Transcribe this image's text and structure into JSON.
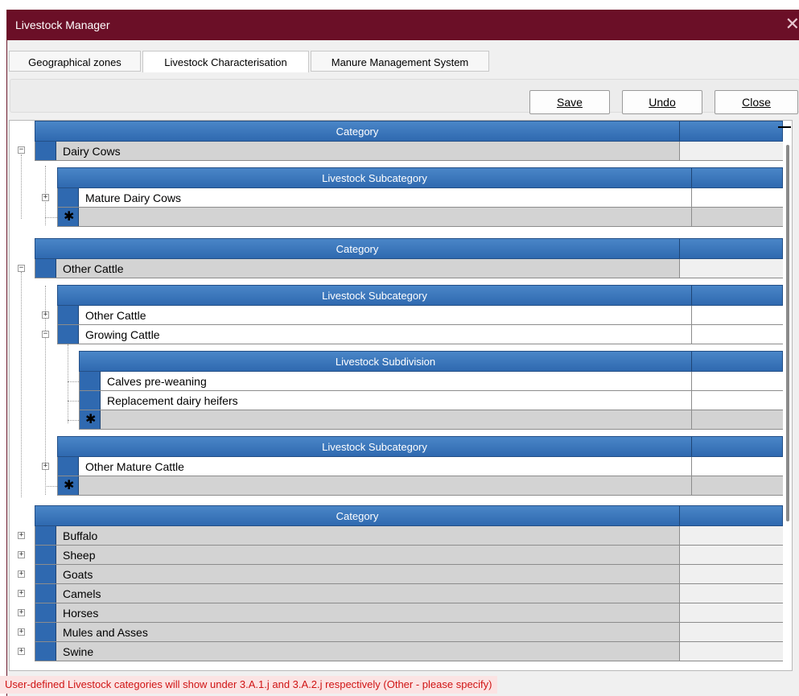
{
  "window": {
    "title": "Livestock Manager",
    "close_glyph": "✕"
  },
  "tabs": [
    {
      "label": "Geographical zones",
      "active": false
    },
    {
      "label": "Livestock Characterisation",
      "active": true
    },
    {
      "label": "Manure Management System",
      "active": false
    }
  ],
  "toolbar": {
    "save_label": "Save",
    "undo_label": "Undo",
    "close_label": "Close"
  },
  "headers": {
    "category": "Category",
    "subcategory": "Livestock Subcategory",
    "subdivision": "Livestock Subdivision"
  },
  "new_row_glyph": "✱",
  "expand_glyph": "+",
  "collapse_glyph": "−",
  "tree": {
    "dairy_cows": {
      "label": "Dairy Cows",
      "subcategories": [
        "Mature Dairy Cows"
      ]
    },
    "other_cattle": {
      "label": "Other Cattle",
      "subcategories": [
        "Other Cattle",
        "Growing Cattle"
      ],
      "growing_subdivisions": [
        "Calves pre-weaning",
        "Replacement dairy heifers"
      ],
      "subcategories_2": [
        "Other Mature Cattle"
      ]
    },
    "other_categories": [
      "Buffalo",
      "Sheep",
      "Goats",
      "Camels",
      "Horses",
      "Mules and Asses",
      "Swine"
    ]
  },
  "status_message": "User-defined Livestock categories will show under 3.A.1.j and 3.A.2.j respectively (Other - please specify)",
  "colors": {
    "titlebar": "#6b0f27",
    "header_blue": "#2f69b0",
    "status_text": "#d01414"
  }
}
